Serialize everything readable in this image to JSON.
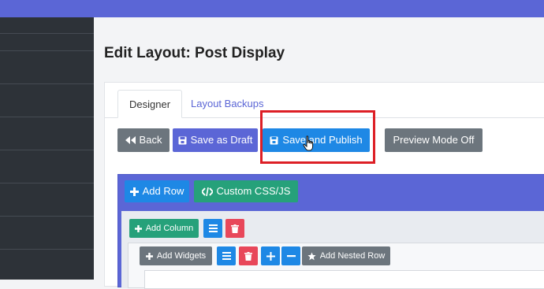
{
  "page": {
    "title": "Edit Layout: Post Display"
  },
  "tabs": [
    {
      "label": "Designer",
      "active": true
    },
    {
      "label": "Layout Backups",
      "active": false
    }
  ],
  "toolbar": {
    "back_label": "Back",
    "save_draft_label": "Save as Draft",
    "save_publish_label": "Save and Publish",
    "preview_label": "Preview Mode Off"
  },
  "builder": {
    "add_row_label": "Add Row",
    "custom_css_label": "Custom CSS/JS",
    "add_column_label": "Add Column",
    "add_widgets_label": "Add Widgets",
    "add_nested_row_label": "Add Nested Row"
  },
  "colors": {
    "topbar": "#5b66d6",
    "sidebar": "#2d3238",
    "primary": "#1e88e5",
    "indigo": "#5b66d6",
    "success": "#26a17a",
    "danger": "#e8475a",
    "secondary": "#6c757d",
    "highlight": "#dd1f26"
  }
}
